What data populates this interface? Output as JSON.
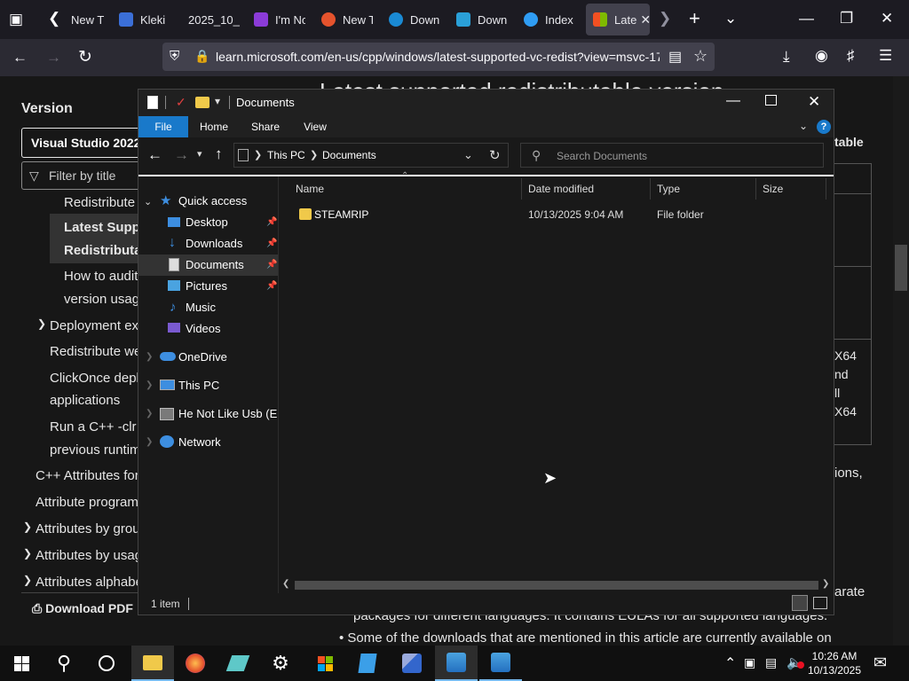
{
  "browser": {
    "tabs": [
      {
        "label": "New T",
        "color": "#5a5a66"
      },
      {
        "label": "Kleki -",
        "color": "#3b6fd8"
      },
      {
        "label": "2025_10_1",
        "color": "#1c1b22"
      },
      {
        "label": "I'm No",
        "color": "#8b3bd8"
      },
      {
        "label": "New T",
        "color": "#e5532d"
      },
      {
        "label": "Down",
        "color": "#1a8ad4"
      },
      {
        "label": "Down",
        "color": "#2aa0d8"
      },
      {
        "label": "Index",
        "color": "#2f9df4"
      },
      {
        "label": "Late",
        "color": "#f25022"
      }
    ],
    "url": "learn.microsoft.com/en-us/cpp/windows/latest-supported-vc-redist?view=msvc-17"
  },
  "page": {
    "heading_partial": "Latest supported redistributable version",
    "sidebar_title": "Version",
    "version_select": "Visual Studio 2022",
    "filter_placeholder": "Filter by title",
    "toc": [
      "Redistribute a",
      "Latest Suppo",
      "Redistributab",
      "How to audit",
      "version usage",
      "Deployment exa",
      "Redistribute we",
      "ClickOnce deplo",
      "applications",
      "Run a C++ -clr a",
      "previous runtim",
      "C++ Attributes for",
      "Attribute programm",
      "Attributes by group",
      "Attributes by usage",
      "Attributes alphabet"
    ],
    "download_pdf": "Download PDF",
    "right_frag": [
      "table",
      "X64",
      "nd",
      "ll",
      "X64",
      "ions,",
      "arate"
    ],
    "body_line1": "packages for different languages. It contains EULAs for all supported languages.",
    "body_line2": "Some of the downloads that are mentioned in this article are currently available on"
  },
  "explorer": {
    "title": "Documents",
    "ribbon_tabs": [
      "File",
      "Home",
      "Share",
      "View"
    ],
    "breadcrumb": [
      "This PC",
      "Documents"
    ],
    "search_placeholder": "Search Documents",
    "nav": {
      "quick_access": "Quick access",
      "desktop": "Desktop",
      "downloads": "Downloads",
      "documents": "Documents",
      "pictures": "Pictures",
      "music": "Music",
      "videos": "Videos",
      "onedrive": "OneDrive",
      "this_pc": "This PC",
      "usb": "He Not Like Usb (E:)",
      "network": "Network"
    },
    "columns": {
      "name": "Name",
      "date": "Date modified",
      "type": "Type",
      "size": "Size"
    },
    "files": [
      {
        "name": "STEAMRIP",
        "date": "10/13/2025 9:04 AM",
        "type": "File folder",
        "size": ""
      }
    ],
    "status": "1 item"
  },
  "taskbar": {
    "time": "10:26 AM",
    "date": "10/13/2025"
  }
}
